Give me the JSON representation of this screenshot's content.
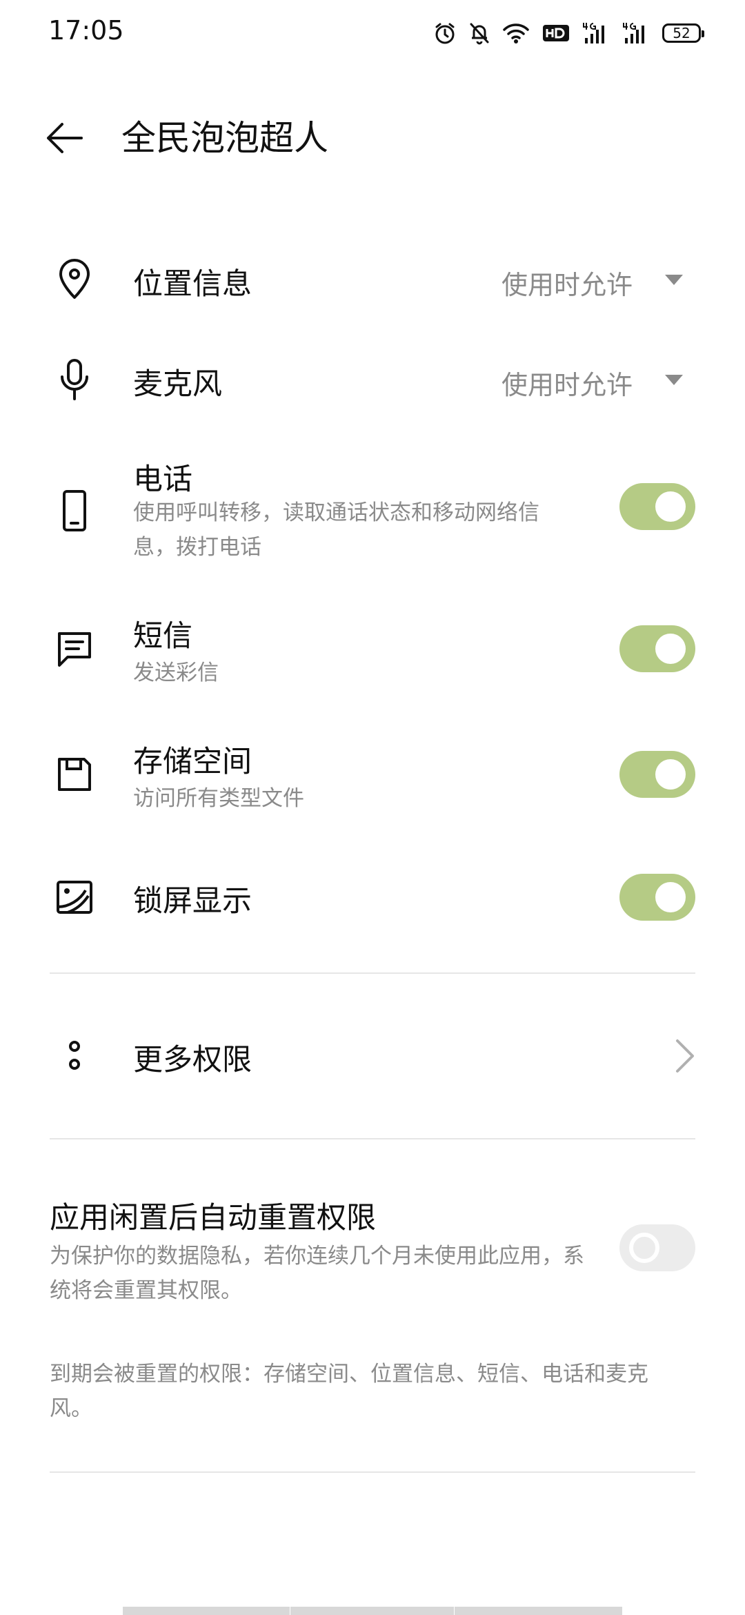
{
  "status_bar": {
    "time": "17:05",
    "battery": "52"
  },
  "header": {
    "title": "全民泡泡超人"
  },
  "permissions": {
    "location": {
      "label": "位置信息",
      "value": "使用时允许"
    },
    "microphone": {
      "label": "麦克风",
      "value": "使用时允许"
    },
    "phone": {
      "label": "电话",
      "description": "使用呼叫转移，读取通话状态和移动网络信息，拨打电话",
      "enabled": true
    },
    "sms": {
      "label": "短信",
      "description": "发送彩信",
      "enabled": true
    },
    "storage": {
      "label": "存储空间",
      "description": "访问所有类型文件",
      "enabled": true
    },
    "lockscreen": {
      "label": "锁屏显示",
      "enabled": true
    }
  },
  "more_permissions": {
    "label": "更多权限"
  },
  "auto_reset": {
    "title": "应用闲置后自动重置权限",
    "description": "为保护你的数据隐私，若你连续几个月未使用此应用，系统将会重置其权限。",
    "enabled": false,
    "footnote": "到期会被重置的权限：存储空间、位置信息、短信、电话和麦克风。"
  },
  "colors": {
    "toggle_on": "#b5cb85",
    "toggle_off": "#ececec",
    "secondary_text": "#8a8a8a"
  }
}
